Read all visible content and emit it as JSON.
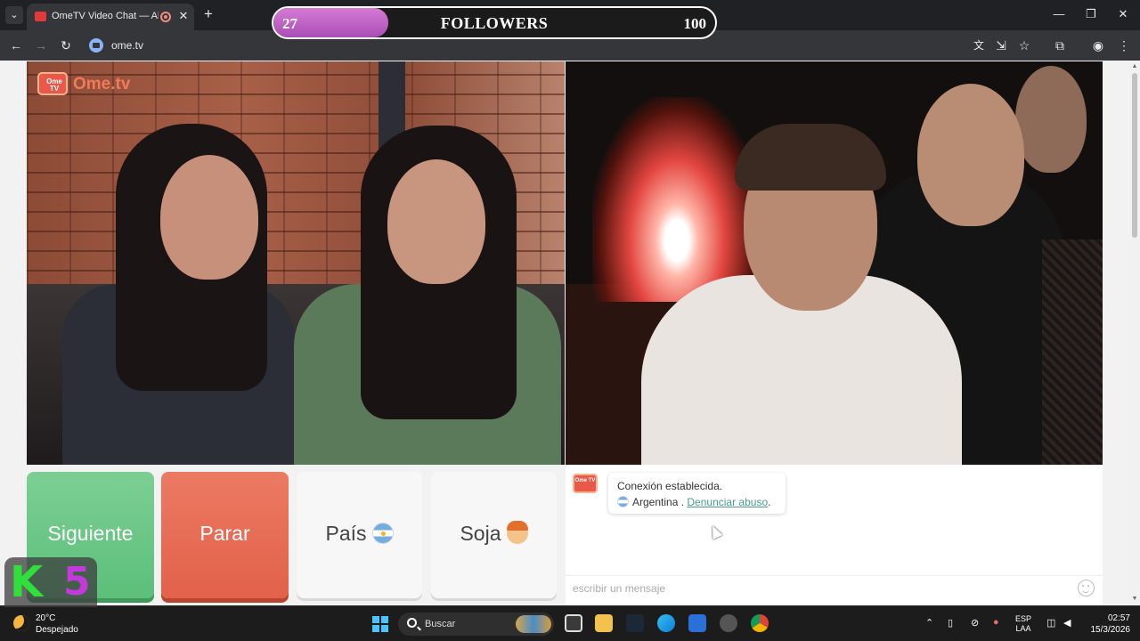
{
  "browser": {
    "tab_title": "OmeTV Video Chat — Alter",
    "url": "ome.tv",
    "new_tab_symbol": "+",
    "close_symbol": "✕"
  },
  "overlay": {
    "followers_current": "27",
    "followers_label": "FOLLOWERS",
    "followers_goal": "100",
    "followers_progress": 0.26,
    "channel_logo_letter": "K",
    "channel_logo_number": "5"
  },
  "ome": {
    "watermark_badge": "Ome TV",
    "watermark_brand": "Ome.tv"
  },
  "controls": {
    "next_label": "Siguiente",
    "stop_label": "Parar",
    "country_label": "País",
    "gender_label": "Soja"
  },
  "chat": {
    "status_line": "Conexión establecida.",
    "country": "Argentina .",
    "report_link": "Denunciar abuso",
    "report_suffix": ".",
    "input_placeholder": "escribir un mensaje"
  },
  "taskbar": {
    "temperature": "20°C",
    "weather": "Despejado",
    "search_placeholder": "Buscar",
    "lang_top": "ESP",
    "lang_bottom": "LAA",
    "time": "02:57",
    "date": "15/3/2026"
  },
  "colors": {
    "next_button": "#5cbf7a",
    "stop_button": "#e2614a",
    "followers_fill": "#c46ccb",
    "link": "#4a9c8c"
  },
  "icons": [
    "tab-search-icon",
    "new-tab-icon",
    "back-icon",
    "forward-icon",
    "reload-icon",
    "translate-icon",
    "install-icon",
    "star-icon",
    "extensions-icon",
    "profile-icon",
    "menu-icon",
    "emoji-icon",
    "windows-start-icon",
    "search-icon"
  ]
}
